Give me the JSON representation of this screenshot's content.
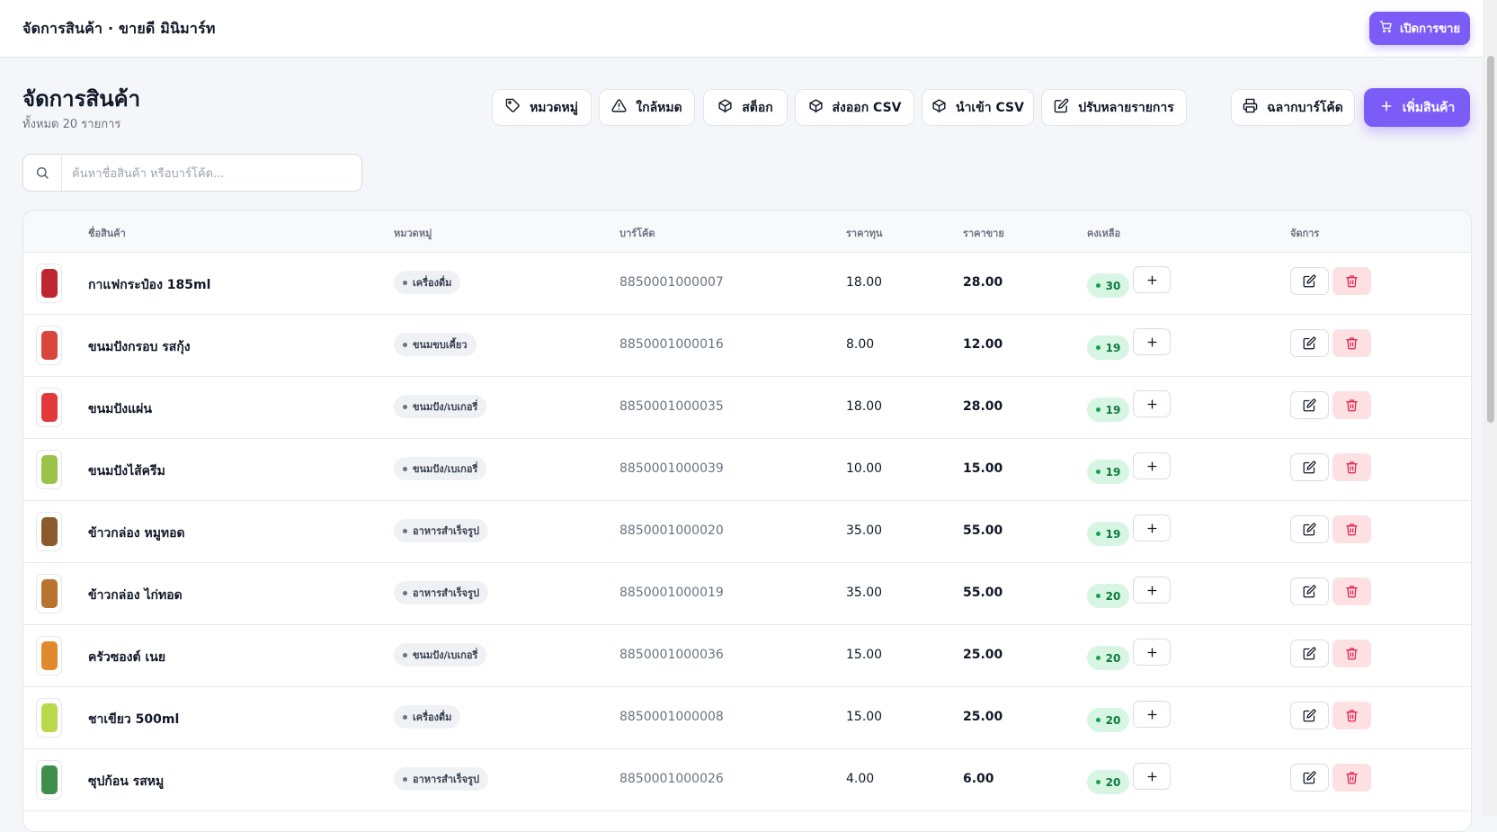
{
  "header": {
    "title": "จัดการสินค้า · ขายดี มินิมาร์ท",
    "pos_button": "เปิดการขาย"
  },
  "page": {
    "title": "จัดการสินค้า",
    "subtitle": "ทั้งหมด 20 รายการ"
  },
  "toolbar": {
    "categories": "หมวดหมู่",
    "low_stock": "ใกล้หมด",
    "stock": "สต็อก",
    "export_csv": "ส่งออก CSV",
    "import_csv": "นำเข้า CSV",
    "bulk_edit": "ปรับหลายรายการ",
    "barcode_label": "ฉลากบาร์โค้ด",
    "add_product": "เพิ่มสินค้า"
  },
  "search": {
    "placeholder": "ค้นหาชื่อสินค้า หรือบาร์โค้ด...",
    "value": ""
  },
  "table": {
    "headers": {
      "name": "ชื่อสินค้า",
      "category": "หมวดหมู่",
      "barcode": "บาร์โค้ด",
      "cost": "ราคาทุน",
      "price": "ราคาขาย",
      "stock": "คงเหลือ",
      "actions": "จัดการ"
    },
    "rows": [
      {
        "name": "กาแฟกระป๋อง 185ml",
        "category": "เครื่องดื่ม",
        "barcode": "8850001000007",
        "cost": "18.00",
        "price": "28.00",
        "stock": "30",
        "thumb_color": "#c0262d"
      },
      {
        "name": "ขนมปังกรอบ รสกุ้ง",
        "category": "ขนมขบเคี้ยว",
        "barcode": "8850001000016",
        "cost": "8.00",
        "price": "12.00",
        "stock": "19",
        "thumb_color": "#d9463d"
      },
      {
        "name": "ขนมปังแผ่น",
        "category": "ขนมปัง/เบเกอรี่",
        "barcode": "8850001000035",
        "cost": "18.00",
        "price": "28.00",
        "stock": "19",
        "thumb_color": "#e23a3a"
      },
      {
        "name": "ขนมปังไส้ครีม",
        "category": "ขนมปัง/เบเกอรี่",
        "barcode": "8850001000039",
        "cost": "10.00",
        "price": "15.00",
        "stock": "19",
        "thumb_color": "#9bc34a"
      },
      {
        "name": "ข้าวกล่อง หมูทอด",
        "category": "อาหารสำเร็จรูป",
        "barcode": "8850001000020",
        "cost": "35.00",
        "price": "55.00",
        "stock": "19",
        "thumb_color": "#8a5a2b"
      },
      {
        "name": "ข้าวกล่อง ไก่ทอด",
        "category": "อาหารสำเร็จรูป",
        "barcode": "8850001000019",
        "cost": "35.00",
        "price": "55.00",
        "stock": "20",
        "thumb_color": "#b8742f"
      },
      {
        "name": "ครัวซองต์ เนย",
        "category": "ขนมปัง/เบเกอรี่",
        "barcode": "8850001000036",
        "cost": "15.00",
        "price": "25.00",
        "stock": "20",
        "thumb_color": "#e08a2c"
      },
      {
        "name": "ชาเขียว 500ml",
        "category": "เครื่องดื่ม",
        "barcode": "8850001000008",
        "cost": "15.00",
        "price": "25.00",
        "stock": "20",
        "thumb_color": "#b9d94a"
      },
      {
        "name": "ซุปก้อน รสหมู",
        "category": "อาหารสำเร็จรูป",
        "barcode": "8850001000026",
        "cost": "4.00",
        "price": "6.00",
        "stock": "20",
        "thumb_color": "#3f8f4a"
      }
    ]
  },
  "colors": {
    "accent": "#7c5cf6",
    "stock_badge_bg": "#d7f5e3",
    "stock_badge_text": "#0f7a3e",
    "delete_bg": "#fde0e2",
    "delete_icon": "#e11d48"
  }
}
